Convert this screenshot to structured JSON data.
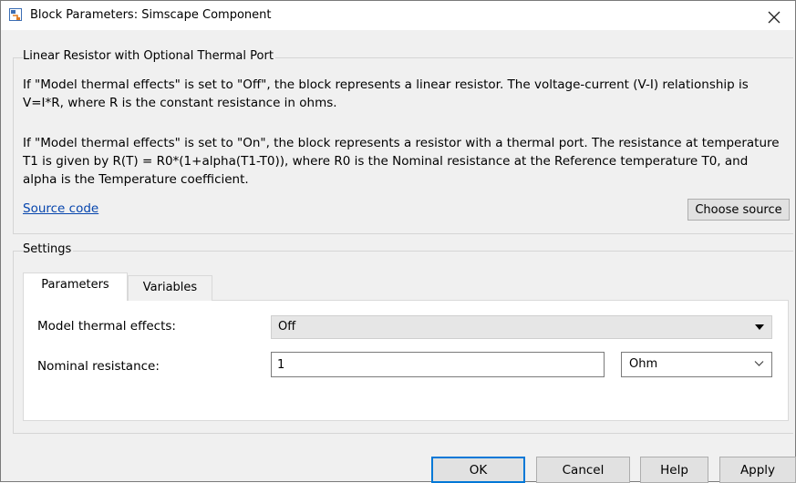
{
  "window": {
    "title": "Block Parameters: Simscape Component",
    "close_symbol": "✕"
  },
  "description": {
    "group_title": "Linear Resistor with Optional Thermal Port",
    "paragraph1": "If \"Model thermal effects\" is set to \"Off\", the block represents a linear resistor. The voltage-current (V-I) relationship is V=I*R, where R is the constant resistance in ohms.",
    "paragraph2": "If \"Model thermal effects\" is set to \"On\", the block represents a resistor with a thermal port. The resistance at temperature T1 is given by R(T) = R0*(1+alpha(T1-T0)), where R0 is the Nominal resistance at the Reference temperature T0, and alpha is the Temperature coefficient.",
    "source_link": "Source code",
    "choose_source": "Choose source"
  },
  "settings": {
    "group_title": "Settings",
    "tabs": [
      {
        "label": "Parameters",
        "active": true
      },
      {
        "label": "Variables",
        "active": false
      }
    ],
    "rows": {
      "thermal": {
        "label": "Model thermal effects:",
        "value": "Off"
      },
      "resistance": {
        "label": "Nominal resistance:",
        "value": "1",
        "unit": "Ohm"
      }
    }
  },
  "buttons": {
    "ok": "OK",
    "cancel": "Cancel",
    "help": "Help",
    "apply": "Apply"
  },
  "colors": {
    "link": "#0645ad",
    "default_button_border": "#0078d7",
    "dialog_background": "#f0f0f0"
  },
  "icons": {
    "app": "simulink-block-icon",
    "close": "close-icon",
    "dropdown": "dropdown-arrow-icon",
    "chevron": "chevron-down-icon"
  }
}
